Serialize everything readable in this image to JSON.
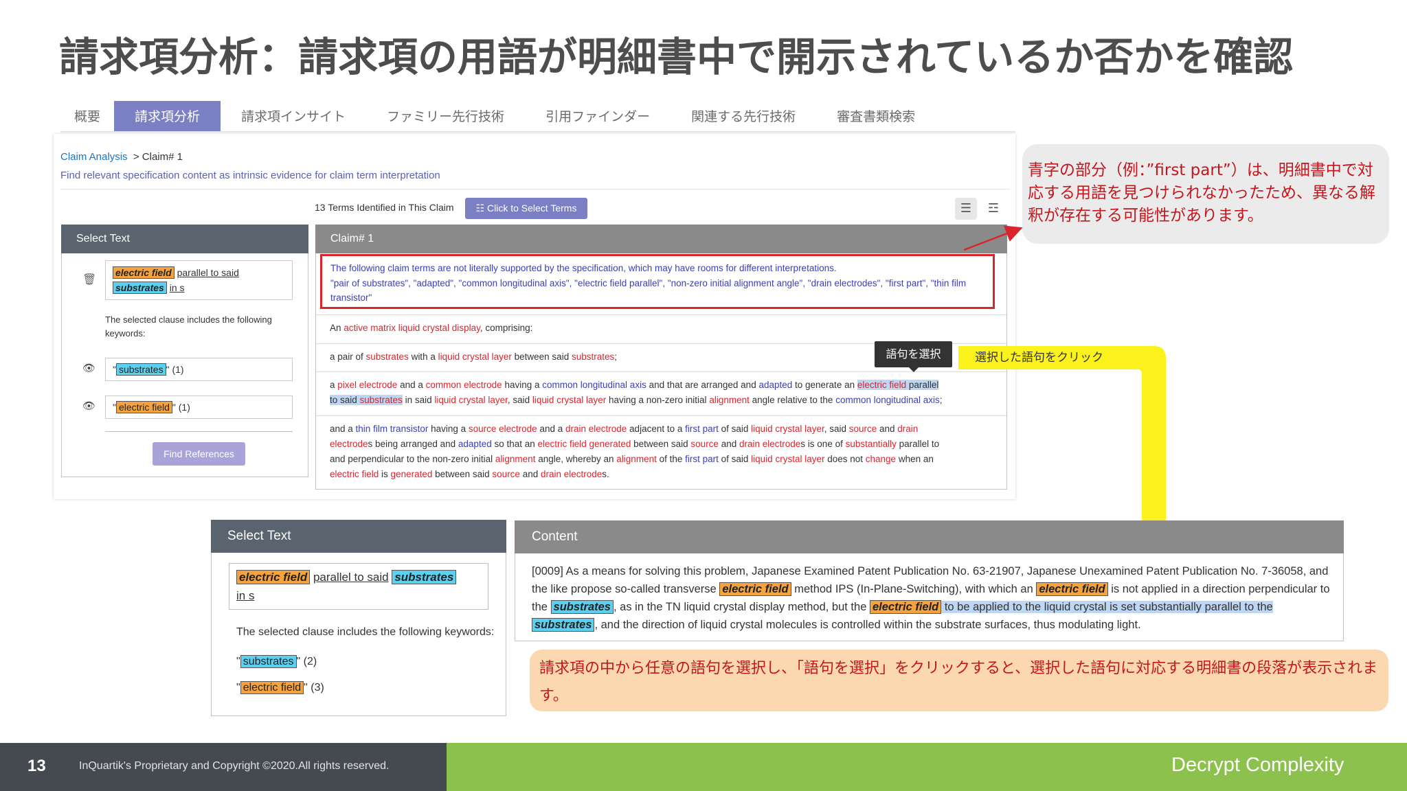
{
  "slide": {
    "title": "請求項分析：請求項の用語が明細書中で開示されているか否かを確認",
    "page_number": "13",
    "copyright": "InQuartik's Proprietary and Copyright ©2020.All rights reserved.",
    "tagline": "Decrypt Complexity"
  },
  "tabs": [
    {
      "label": "概要",
      "active": false
    },
    {
      "label": "請求項分析",
      "active": true
    },
    {
      "label": "請求項インサイト",
      "active": false
    },
    {
      "label": "ファミリー先行技術",
      "active": false
    },
    {
      "label": "引用ファインダー",
      "active": false
    },
    {
      "label": "関連する先行技術",
      "active": false
    },
    {
      "label": "審査書類検索",
      "active": false
    }
  ],
  "breadcrumb": {
    "link": "Claim Analysis",
    "current": "> Claim# 1"
  },
  "description": "Find relevant specification content as intrinsic evidence for claim term interpretation",
  "toolbar": {
    "terms_count": "13 Terms Identified in This Claim",
    "select_terms_label": "Click to Select Terms",
    "select_terms_icon": "☷"
  },
  "select_panel_small": {
    "header": "Select Text",
    "term1": "electric field",
    "between": "parallel to said",
    "term2": "substrates",
    "tail": "in s",
    "keywords_note": "The selected clause includes the following keywords:",
    "kw1": {
      "label": "substrates",
      "count": "\" (1)"
    },
    "kw2": {
      "label": "electric field",
      "count": "\" (1)"
    },
    "find_label": "Find References"
  },
  "claim_panel": {
    "header": "Claim# 1",
    "notice_line1": "The following claim terms are not literally supported by the specification, which may have rooms for different interpretations.",
    "notice_line2": "\"pair of substrates\", \"adapted\", \"common longitudinal axis\", \"electric field parallel\", \"non-zero initial alignment angle\", \"drain electrodes\", \"first part\", \"thin film transistor\"",
    "row1": {
      "a": "An ",
      "b": "active matrix liquid crystal display",
      "c": ", comprising:"
    },
    "row2": {
      "a": "a pair of ",
      "b": "substrates",
      "c": " with a ",
      "d": "liquid crystal layer",
      "e": " between said ",
      "f": "substrates",
      "g": ";"
    },
    "row3": {
      "t1": "a ",
      "t2": "pixel electrode",
      "t3": " and a ",
      "t4": "common electrode",
      "t5": " having a ",
      "t6": "common longitudinal axis",
      "t7": " and that are arranged and ",
      "t8": "adapted",
      "t9": " to generate an ",
      "t10": "electric field",
      "t11": " parallel",
      "t12": "to said ",
      "t13": "substrates",
      "t14": " in said ",
      "t15": "liquid crystal layer",
      "t16": ", said ",
      "t17": "liquid crystal layer",
      "t18": " having a non-zero initial ",
      "t19": "alignment",
      "t20": " angle relative to the ",
      "t21": "common longitudinal axis",
      "t22": ";"
    },
    "row4": {
      "t1": "and a ",
      "t2": "thin film transistor",
      "t3": " having a ",
      "t4": "source electrode",
      "t5": " and a ",
      "t6": "drain electrode",
      "t7": " adjacent to a ",
      "t8": "first part",
      "t9": " of said ",
      "t10": "liquid crystal layer",
      "t11": ", said ",
      "t12": "source",
      "t13": " and ",
      "t14": "drain",
      "t15": "electrode",
      "t16": "s being arranged and ",
      "t17": "adapted",
      "t18": " so that an ",
      "t19": "electric field generated",
      "t20": " between said ",
      "t21": "source",
      "t22": " and ",
      "t23": "drain electrode",
      "t24": "s is one of ",
      "t25": "substantially",
      "t26": " parallel to",
      "t27": "and perpendicular to the non-zero initial ",
      "t28": "alignment",
      "t29": " angle, whereby an ",
      "t30": "alignment",
      "t31": " of the ",
      "t32": "first part",
      "t33": " of said ",
      "t34": "liquid crystal layer",
      "t35": " does not ",
      "t36": "change",
      "t37": " when an",
      "t38": "electric field",
      "t39": " is ",
      "t40": "generated",
      "t41": " between said ",
      "t42": "source",
      "t43": " and ",
      "t44": "drain electrode",
      "t45": "s."
    }
  },
  "tooltip": "語句を選択",
  "yellow_label": "選択した語句をクリック",
  "callout": "青字の部分（例：”first part”）は、明細書中で対応する用語を見つけられなかったため、異なる解釈が存在する可能性があります。",
  "select_panel_large": {
    "header": "Select Text",
    "term1": "electric field",
    "between": "parallel to said",
    "term2": "substrates",
    "tail": "in s",
    "keywords_note": "The selected clause includes the following keywords:",
    "kw1": {
      "label": "substrates",
      "count": "\" (2)"
    },
    "kw2": {
      "label": "electric field",
      "count": "\" (3)"
    }
  },
  "content_panel": {
    "header": "Content",
    "p1": "[0009] As a means for solving this problem, Japanese Examined Patent Publication No. 63-21907, Japanese Unexamined Patent Publication No. 7-36058, and the like propose so-called transverse ",
    "h1": "electric field",
    "p2": " method IPS (In-Plane-Switching), with which an ",
    "h2": "electric field",
    "p3": " is not applied in a direction perpendicular to the ",
    "h3": "substrates",
    "p4": ", as in the TN liquid crystal display method, but the ",
    "h4": "electric field",
    "p5": " to be applied to the liquid crystal is set substantially parallel to the ",
    "h5": "substrates",
    "p6": ", and the direction of liquid crystal molecules is controlled within the substrate surfaces, thus modulating light."
  },
  "orange_note": "請求項の中から任意の語句を選択し、「語句を選択」をクリックすると、選択した語句に対応する明細書の段落が表示されます。",
  "colors": {
    "accent": "#7b7fc4",
    "term_red": "#d8262f",
    "term_blue": "#3a3fb5",
    "highlight_orange": "#f6a33e",
    "highlight_cyan": "#5bd0f1",
    "footer_green": "#8dc14d",
    "arrow_yellow": "#fbf11b"
  }
}
